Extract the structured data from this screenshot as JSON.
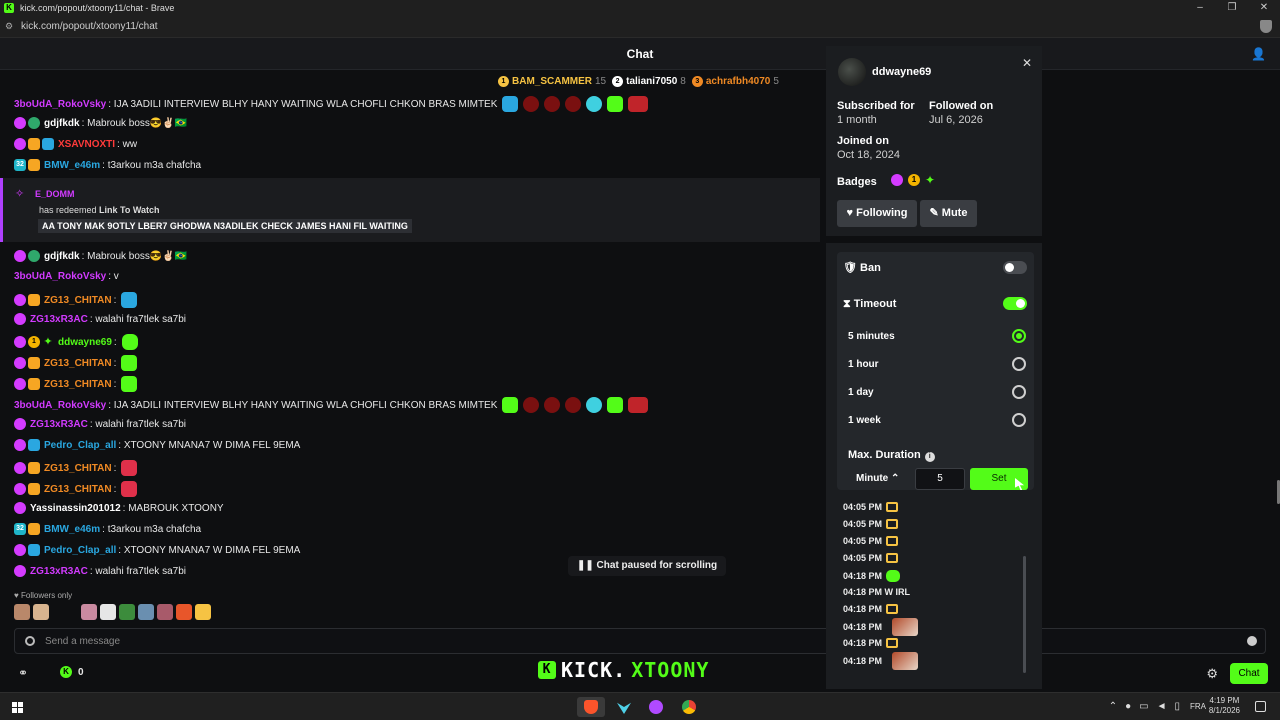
{
  "browser": {
    "window_title": "kick.com/popout/xtoony11/chat - Brave",
    "url": "kick.com/popout/xtoony11/chat",
    "window_buttons": [
      "–",
      "❐",
      "✕"
    ]
  },
  "chat": {
    "title": "Chat",
    "gifters": [
      {
        "rank": "1",
        "name": "BAM_SCAMMER",
        "count": "15",
        "color": "#f6c343"
      },
      {
        "rank": "2",
        "name": "taliani7050",
        "count": "8",
        "color": "#ffffff"
      },
      {
        "rank": "3",
        "name": "achrafbh4070",
        "count": "5",
        "color": "#f08a24"
      }
    ],
    "messages": [
      {
        "user": "3boUdA_RokoVsky",
        "color": "#d23bff",
        "text": ": IJA 3ADILI INTERVIEW BLHY HANY WAITING WLA CHOFLI CHKON BRAS MIMTEK"
      },
      {
        "user": "gdjfkdk",
        "color": "#ffffff",
        "text": ": Mabrouk boss😎✌🏻🇧🇷"
      },
      {
        "user": "XSAVNOXTI",
        "color": "#ff3b3b",
        "text": ": ww"
      },
      {
        "user": "BMW_e46m",
        "color": "#2aa7e0",
        "text": ": t3arkou m3a chafcha"
      },
      {
        "user": "gdjfkdk",
        "color": "#ffffff",
        "text": ": Mabrouk boss😎✌🏻🇧🇷"
      },
      {
        "user": "3boUdA_RokoVsky",
        "color": "#d23bff",
        "text": ": v"
      },
      {
        "user": "ZG13_CHITAN",
        "color": "#f08a24",
        "text": ":"
      },
      {
        "user": "ZG13xR3AC",
        "color": "#d23bff",
        "text": ": walahi fra7tlek sa7bi"
      },
      {
        "user": "ddwayne69",
        "color": "#53fc18",
        "text": ":"
      },
      {
        "user": "ZG13_CHITAN",
        "color": "#f08a24",
        "text": ":"
      },
      {
        "user": "ZG13_CHITAN",
        "color": "#f08a24",
        "text": ":"
      },
      {
        "user": "3boUdA_RokoVsky",
        "color": "#d23bff",
        "text": ": IJA 3ADILI INTERVIEW BLHY HANY WAITING WLA CHOFLI CHKON BRAS MIMTEK"
      },
      {
        "user": "ZG13xR3AC",
        "color": "#d23bff",
        "text": ": walahi fra7tlek sa7bi"
      },
      {
        "user": "Pedro_Clap_all",
        "color": "#2aa7e0",
        "text": ": XTOONY MNANA7 W DIMA FEL 9EMA"
      },
      {
        "user": "ZG13_CHITAN",
        "color": "#f08a24",
        "text": ":"
      },
      {
        "user": "ZG13_CHITAN",
        "color": "#f08a24",
        "text": ":"
      },
      {
        "user": "Yassinassin201012",
        "color": "#ffffff",
        "text": ": MABROUK XTOONY"
      },
      {
        "user": "BMW_e46m",
        "color": "#2aa7e0",
        "text": ": t3arkou m3a chafcha"
      },
      {
        "user": "Pedro_Clap_all",
        "color": "#2aa7e0",
        "text": ": XTOONY MNANA7 W DIMA FEL 9EMA"
      },
      {
        "user": "ZG13xR3AC",
        "color": "#d23bff",
        "text": ": walahi fra7tlek sa7bi"
      }
    ],
    "badge_number": "32",
    "badge_one": "1",
    "redeem": {
      "user": "E_DOMM",
      "prefix": "has redeemed ",
      "reward": "Link To Watch",
      "message": "AA TONY MAK 9OTLY LBER7 GHODWA N3ADILEK CHECK JAMES HANI FIL WAITING"
    },
    "paused_label": "Chat paused for scrolling",
    "followers_only": "Followers only",
    "composer_placeholder": "Send a message",
    "kick_points": "0",
    "chat_button": "Chat",
    "brand": {
      "prefix": "KICK.",
      "name": "XTOONY"
    }
  },
  "user_card": {
    "username": "ddwayne69",
    "subscribed_label": "Subscribed for",
    "subscribed_value": "1 month",
    "followed_label": "Followed on",
    "followed_value": "Jul 6, 2026",
    "joined_label": "Joined on",
    "joined_value": "Oct 18, 2024",
    "badges_label": "Badges",
    "badge_one": "1",
    "following_button": "Following",
    "mute_button": "Mute"
  },
  "moderation": {
    "ban_label": "Ban",
    "ban_enabled": false,
    "timeout_label": "Timeout",
    "timeout_enabled": true,
    "options": [
      {
        "label": "5 minutes",
        "selected": true
      },
      {
        "label": "1 hour",
        "selected": false
      },
      {
        "label": "1 day",
        "selected": false
      },
      {
        "label": "1 week",
        "selected": false
      }
    ],
    "max_duration_label": "Max. Duration",
    "unit": "Minute",
    "duration_value": "5",
    "set_button": "Set"
  },
  "history": [
    {
      "time": "04:05 PM",
      "kind": "icon"
    },
    {
      "time": "04:05 PM",
      "kind": "icon"
    },
    {
      "time": "04:05 PM",
      "kind": "icon"
    },
    {
      "time": "04:05 PM",
      "kind": "icon"
    },
    {
      "time": "04:18 PM",
      "kind": "emote"
    },
    {
      "time": "04:18 PM W IRL",
      "kind": "text"
    },
    {
      "time": "04:18 PM",
      "kind": "icon"
    },
    {
      "time": "04:18 PM",
      "kind": "image"
    },
    {
      "time": "04:18 PM",
      "kind": "icon"
    },
    {
      "time": "04:18 PM",
      "kind": "image"
    }
  ],
  "taskbar": {
    "language": "FRA",
    "time": "4:19 PM",
    "date": "8/1/2026",
    "apps": [
      "brave-app",
      "wing-app",
      "spotify-app",
      "chrome-app"
    ]
  }
}
